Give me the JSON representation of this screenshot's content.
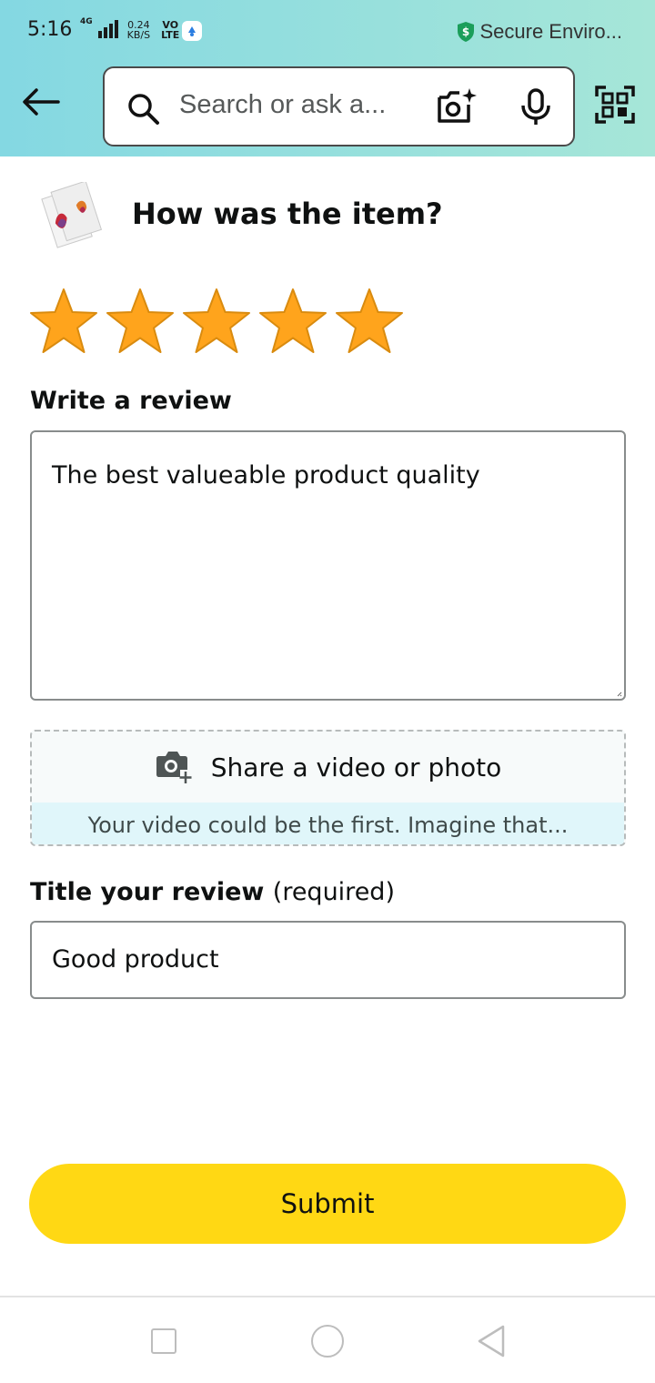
{
  "status_bar": {
    "time": "5:16",
    "network_type": "4G",
    "net_speed_value": "0.24",
    "net_speed_unit": "KB/S",
    "volte_top": "VO",
    "volte_bottom": "LTE",
    "secure_text": "Secure Enviro..."
  },
  "header": {
    "search_placeholder": "Search or ask a..."
  },
  "review": {
    "question": "How was the item?",
    "rating": 5,
    "rating_max": 5,
    "star_color": "#ffa41c",
    "write_label": "Write a review",
    "review_text": "The best valueable product quality",
    "media_label": "Share a video or photo",
    "media_hint": "Your video could be the first. Imagine that...",
    "title_label": "Title your review",
    "title_label_suffix": "(required)",
    "title_value": "Good product",
    "submit_label": "Submit"
  },
  "colors": {
    "submit_button": "#ffd814",
    "header_gradient_start": "#84d8e2",
    "header_gradient_end": "#a6e6d8"
  }
}
